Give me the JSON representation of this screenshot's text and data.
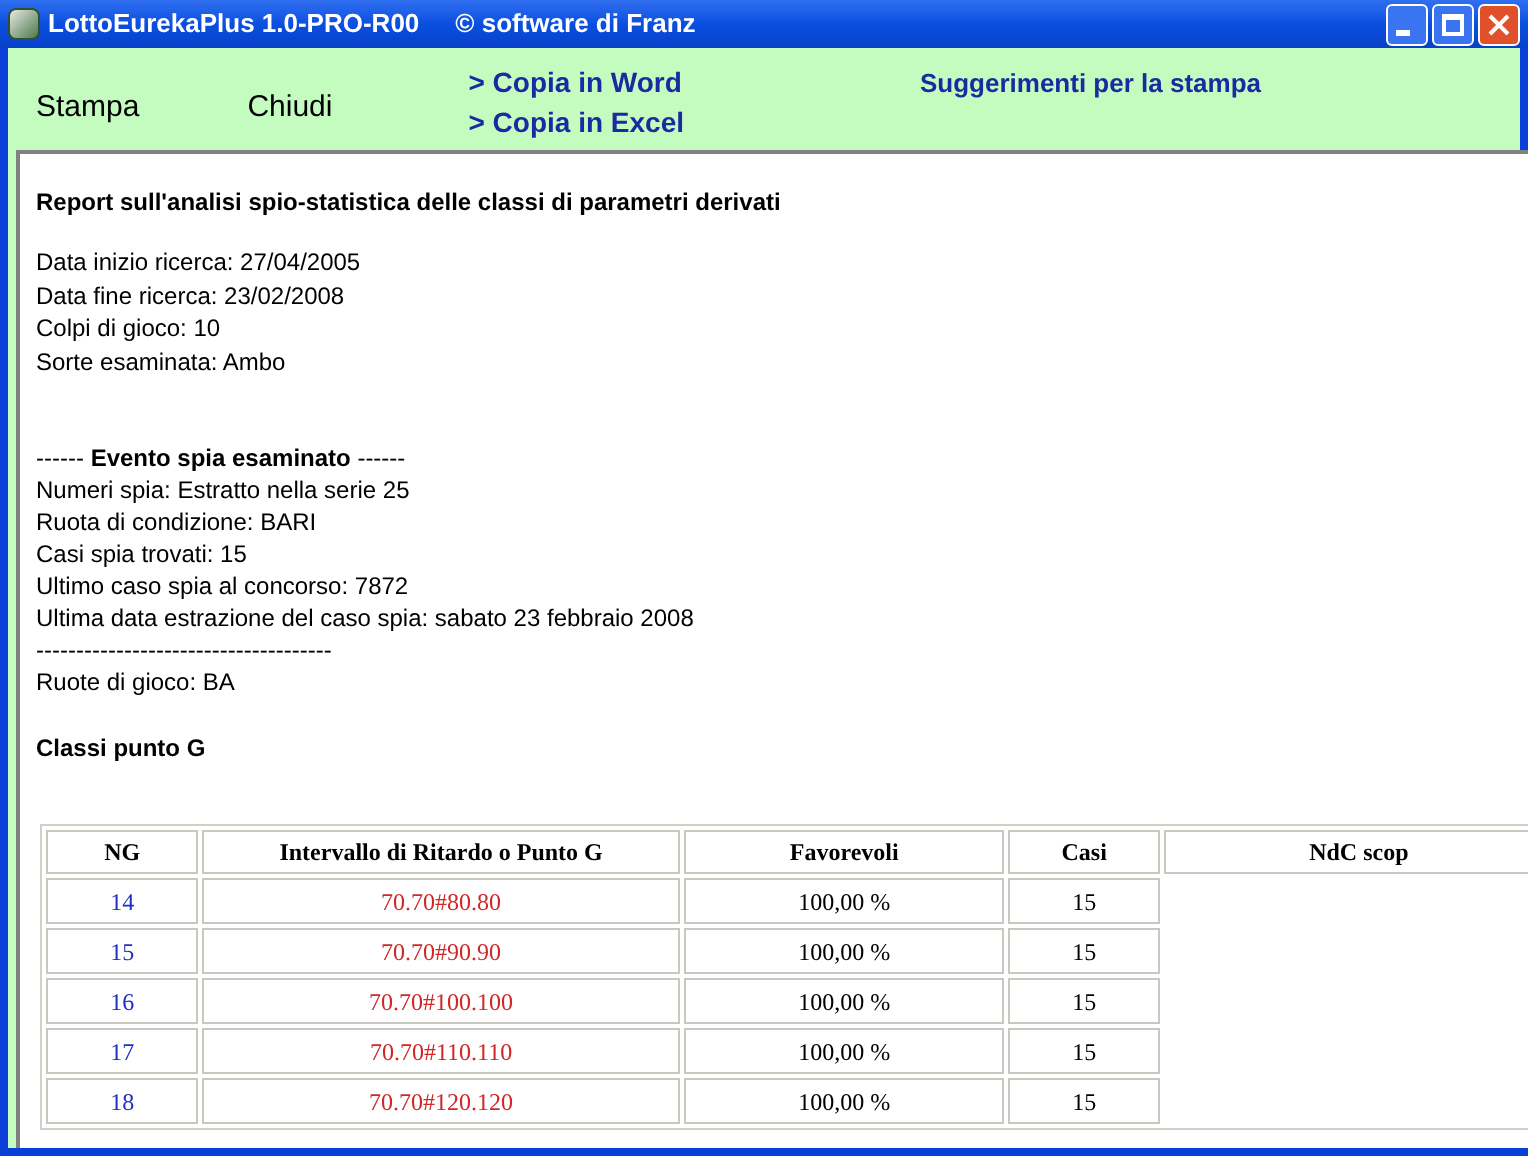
{
  "window": {
    "title": "LottoEurekaPlus 1.0-PRO-R00",
    "subtitle": "© software di Franz"
  },
  "toolbar": {
    "buttons": [
      "Stampa",
      "Chiudi"
    ],
    "links": [
      "> Copia in Word",
      "> Copia in Excel"
    ],
    "hint_link": "Suggerimenti per la stampa"
  },
  "report": {
    "title": "Report sull'analisi spio-statistica delle classi di parametri derivati",
    "params": [
      "Data inizio ricerca: 27/04/2005",
      "Data fine ricerca: 23/02/2008",
      "Colpi di gioco: 10",
      "Sorte esaminata: Ambo"
    ],
    "spy_heading": "------ **Evento spia esaminato** ------",
    "spy_lines": [
      "Numeri spia: Estratto nella serie 25",
      "Ruota di condizione: BARI",
      "Casi spia trovati: 15",
      "Ultimo caso spia al concorso: 7872",
      "Ultima data estrazione del caso spia: sabato 23 febbraio 2008"
    ],
    "separator": "-------------------------------------",
    "wheels": "Ruote di gioco: BA",
    "section_title": "Classi punto G"
  },
  "table": {
    "columns": [
      "NG",
      "Intervallo di Ritardo o Punto G",
      "Favorevoli",
      "Casi",
      "NdC scop"
    ],
    "rows": [
      {
        "ng": "14",
        "interval": "70.70#80.80",
        "favorable": "100,00 %",
        "cases": "15"
      },
      {
        "ng": "15",
        "interval": "70.70#90.90",
        "favorable": "100,00 %",
        "cases": "15"
      },
      {
        "ng": "16",
        "interval": "70.70#100.100",
        "favorable": "100,00 %",
        "cases": "15"
      },
      {
        "ng": "17",
        "interval": "70.70#110.110",
        "favorable": "100,00 %",
        "cases": "15"
      },
      {
        "ng": "18",
        "interval": "70.70#120.120",
        "favorable": "100,00 %",
        "cases": "15"
      }
    ]
  }
}
